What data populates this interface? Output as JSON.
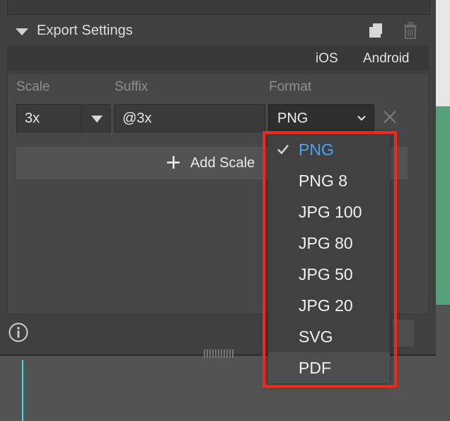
{
  "panel": {
    "section_title": "Export Settings",
    "platform_links": {
      "ios": "iOS",
      "android": "Android"
    }
  },
  "scales": {
    "col_scale": "Scale",
    "col_suffix": "Suffix",
    "col_format": "Format",
    "rows": [
      {
        "scale": "3x",
        "suffix": "@3x",
        "format": "PNG"
      }
    ],
    "add_label": "Add Scale"
  },
  "format_menu": {
    "options": [
      {
        "label": "PNG",
        "selected": true
      },
      {
        "label": "PNG 8",
        "selected": false
      },
      {
        "label": "JPG 100",
        "selected": false
      },
      {
        "label": "JPG 80",
        "selected": false
      },
      {
        "label": "JPG 50",
        "selected": false
      },
      {
        "label": "JPG 20",
        "selected": false
      },
      {
        "label": "SVG",
        "selected": false
      },
      {
        "label": "PDF",
        "selected": false
      }
    ],
    "selected_color": "#4aa3f0",
    "highlight_color": "#f4261d"
  },
  "icons": {
    "disclosure": "triangle-down-icon",
    "new": "new-preset-icon",
    "delete": "trash-icon",
    "chevron": "chevron-down-icon",
    "remove": "close-icon",
    "add": "plus-icon",
    "info": "info-icon",
    "check": "checkmark-icon"
  }
}
